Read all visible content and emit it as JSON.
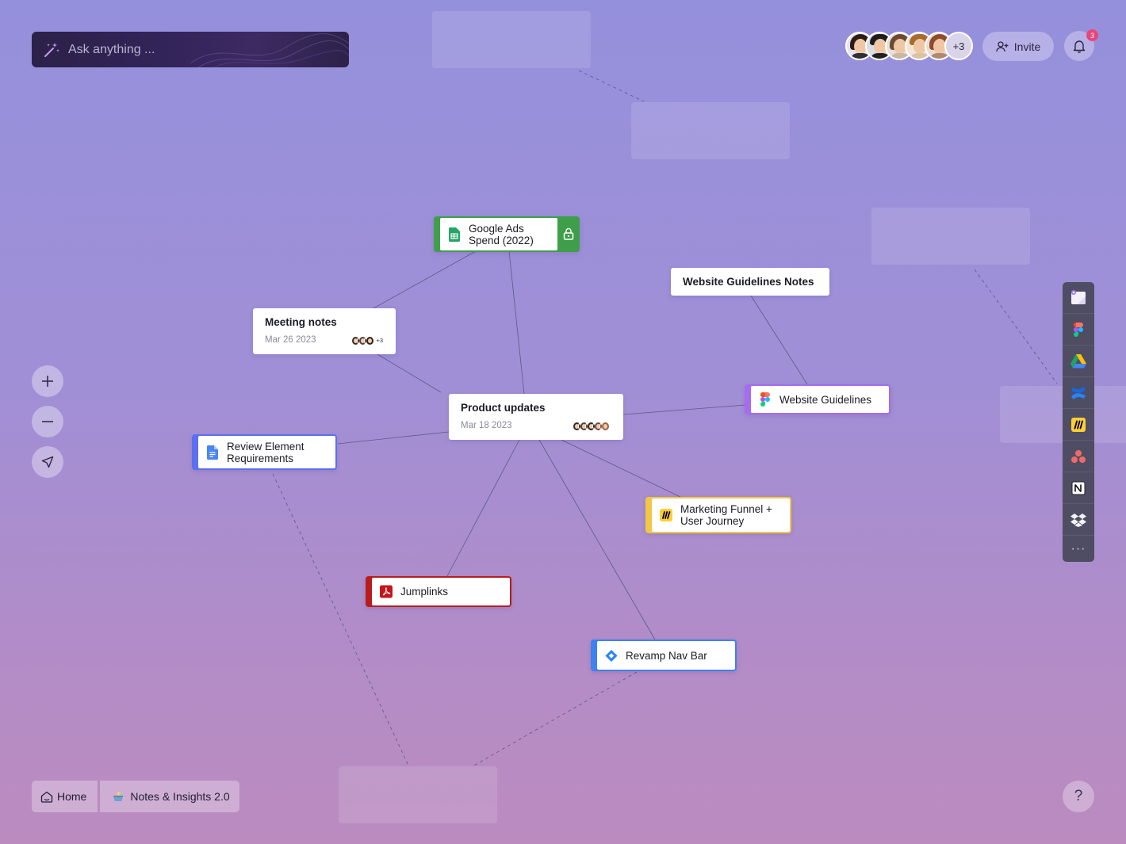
{
  "search": {
    "placeholder": "Ask anything ..."
  },
  "collaborators": {
    "extra_count": "+3"
  },
  "header": {
    "invite_label": "Invite",
    "notification_count": "3"
  },
  "nodes": {
    "google_ads": {
      "title": "Google Ads Spend (2022)",
      "accent": "#3f9e4a"
    },
    "website_notes": {
      "title": "Website Guidelines Notes"
    },
    "meeting_notes": {
      "title": "Meeting notes",
      "date": "Mar 26 2023",
      "extra": "+3"
    },
    "product_updates": {
      "title": "Product updates",
      "date": "Mar 18 2023"
    },
    "website_guidelines": {
      "title": "Website Guidelines",
      "accent": "#a56cef"
    },
    "review_element": {
      "title": "Review Element Requirements",
      "accent": "#5b6ff0"
    },
    "marketing_funnel": {
      "title": "Marketing Funnel + User Journey",
      "accent": "#f2c744"
    },
    "jumplinks": {
      "title": "Jumplinks",
      "accent": "#b91c1c"
    },
    "revamp_nav": {
      "title": "Revamp Nav Bar",
      "accent": "#3c82f0"
    }
  },
  "toolbar": {
    "items": [
      "new-note-icon",
      "figma-icon",
      "google-drive-icon",
      "confluence-icon",
      "miro-icon",
      "asana-icon",
      "notion-icon",
      "dropbox-icon",
      "more-icon"
    ],
    "more": "···"
  },
  "breadcrumb": {
    "home": "Home",
    "current": "Notes & Insights 2.0"
  },
  "help_label": "?"
}
